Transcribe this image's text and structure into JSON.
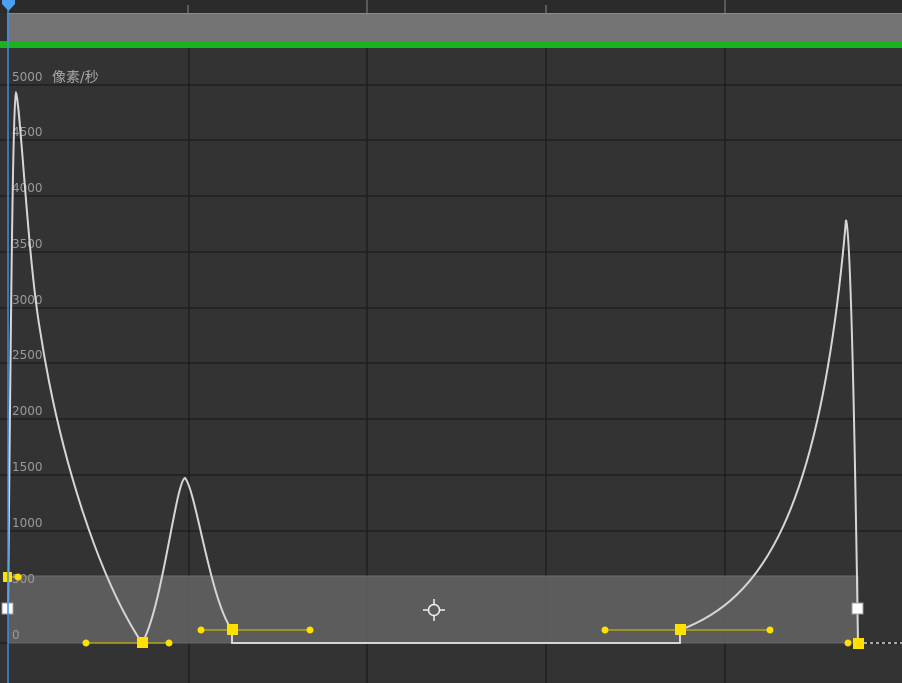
{
  "editor": {
    "unit_label": "像素/秒",
    "y_ticks": [
      "5000",
      "4500",
      "4000",
      "3500",
      "3000",
      "2500",
      "2000",
      "1500",
      "1000",
      "500",
      "0"
    ]
  },
  "colors": {
    "background": "#2f2f2f",
    "grid": "#1f1f1f",
    "curve": "#d9d9d9",
    "keyframe": "#ffe000",
    "handle_line": "#b7a417",
    "selection_box": "#5c5c5c",
    "time_indicator": "#3d8fe0",
    "green_bar": "#17b21c"
  },
  "icons": {
    "current_time_indicator": "playhead-icon",
    "transform_box_center": "crosshair-icon"
  }
}
